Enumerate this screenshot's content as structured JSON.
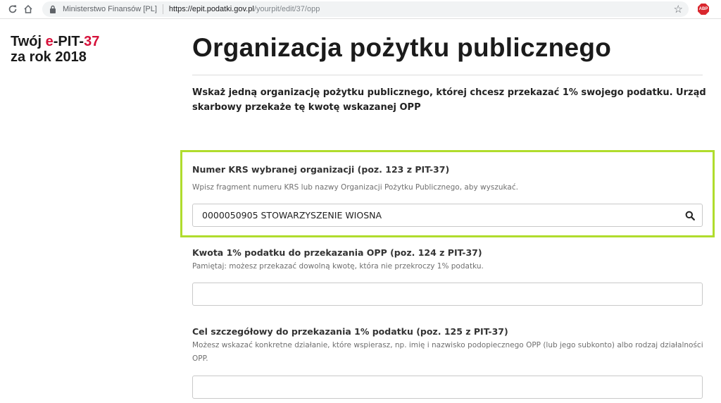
{
  "browser": {
    "site_name": "Ministerstwo Finansów [PL]",
    "url_host": "https://epit.podatki.gov.pl",
    "url_path": "/yourpit/edit/37/opp",
    "extension_label": "ABP"
  },
  "brand": {
    "prefix": "Twój ",
    "e": "e",
    "pit": "-PIT-",
    "num": "37",
    "year_line": "za rok 2018"
  },
  "page": {
    "title": "Organizacja pożytku publicznego",
    "intro": "Wskaż jedną organizację pożytku publicznego, której chcesz przekazać 1% swojego podatku. Urząd skarbowy przekaże tę kwotę wskazanej OPP"
  },
  "fields": {
    "krs": {
      "label": "Numer KRS wybranej organizacji (poz. 123 z PIT-37)",
      "hint": "Wpisz fragment numeru KRS lub nazwy Organizacji Pożytku Publicznego, aby wyszukać.",
      "value": "0000050905 STOWARZYSZENIE WIOSNA"
    },
    "amount": {
      "label": "Kwota 1% podatku do przekazania OPP (poz. 124 z PIT-37)",
      "hint": "Pamiętaj: możesz przekazać dowolną kwotę, która nie przekroczy 1% podatku.",
      "value": ""
    },
    "goal": {
      "label": "Cel szczegółowy do przekazania 1% podatku (poz. 125 z PIT-37)",
      "hint": "Możesz wskazać konkretne działanie, które wspierasz, np. imię i nazwisko podopiecznego OPP (lub jego subkonto) albo rodzaj działalności OPP.",
      "value": ""
    }
  },
  "colors": {
    "brand_accent": "#d6113a",
    "highlight_border": "#b0dc2d"
  }
}
